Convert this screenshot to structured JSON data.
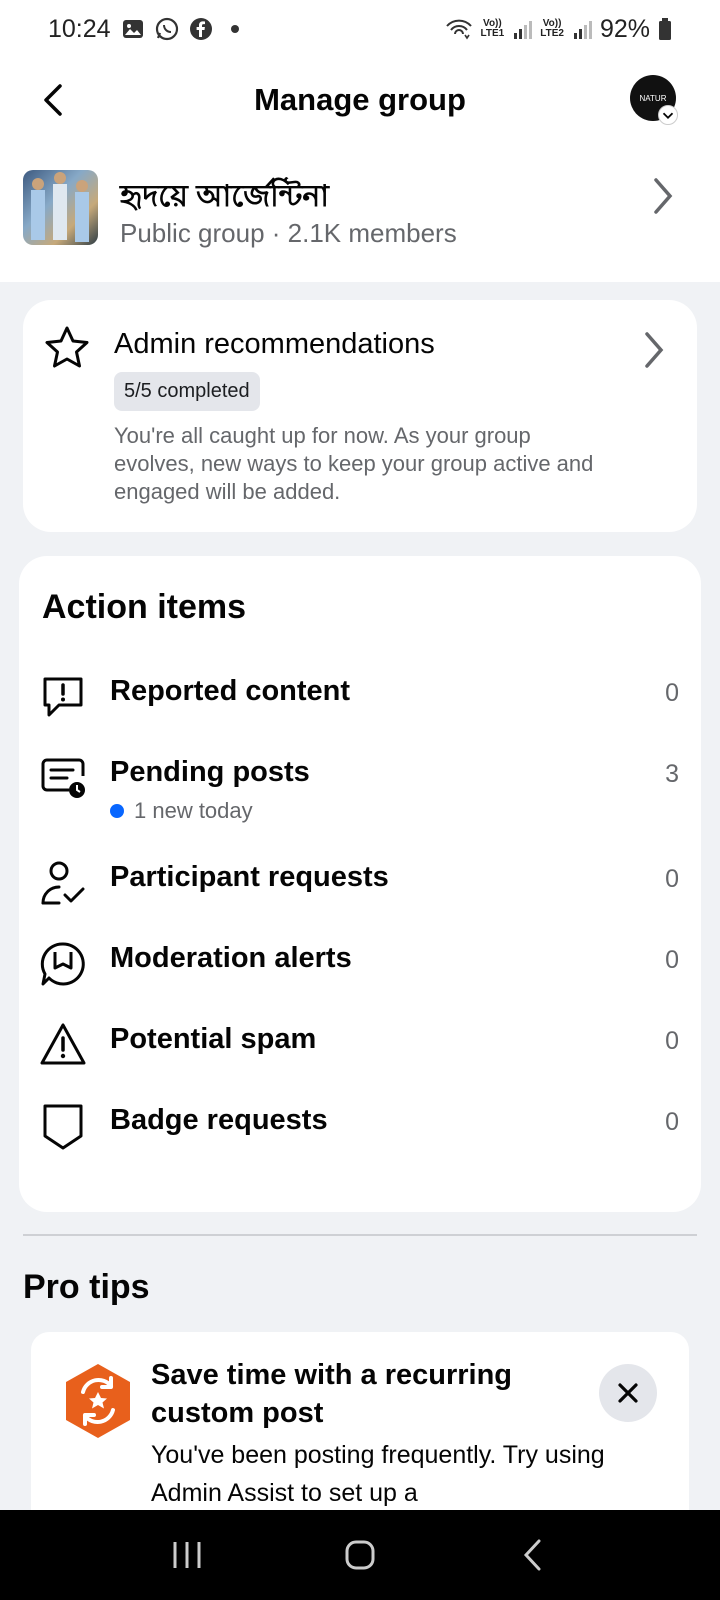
{
  "status_bar": {
    "time": "10:24",
    "battery": "92%",
    "net1": "LTE1",
    "net2": "LTE2",
    "volte": "Vo))"
  },
  "header": {
    "title": "Manage group",
    "avatar_text": "NATUR"
  },
  "group": {
    "name": "হৃদয়ে আর্জেন্টিনা",
    "meta": "Public group · 2.1K members"
  },
  "admin_recommendations": {
    "title": "Admin recommendations",
    "badge": "5/5 completed",
    "description": "You're all caught up for now. As your group evolves, new ways to keep your group active and engaged will be added."
  },
  "action_items": {
    "title": "Action items",
    "items": [
      {
        "label": "Reported content",
        "count": "0",
        "icon": "report-icon"
      },
      {
        "label": "Pending posts",
        "count": "3",
        "sub": "1 new today",
        "icon": "pending-posts-icon"
      },
      {
        "label": "Participant requests",
        "count": "0",
        "icon": "person-check-icon"
      },
      {
        "label": "Moderation alerts",
        "count": "0",
        "icon": "moderation-alert-icon"
      },
      {
        "label": "Potential spam",
        "count": "0",
        "icon": "warning-icon"
      },
      {
        "label": "Badge requests",
        "count": "0",
        "icon": "badge-icon"
      }
    ]
  },
  "pro_tips": {
    "title": "Pro tips",
    "tip": {
      "title": "Save time with a recurring custom post",
      "description": "You've been posting frequently. Try using Admin Assist to set up a"
    }
  },
  "colors": {
    "accent": "#0866ff",
    "tip_icon": "#e8601c"
  }
}
